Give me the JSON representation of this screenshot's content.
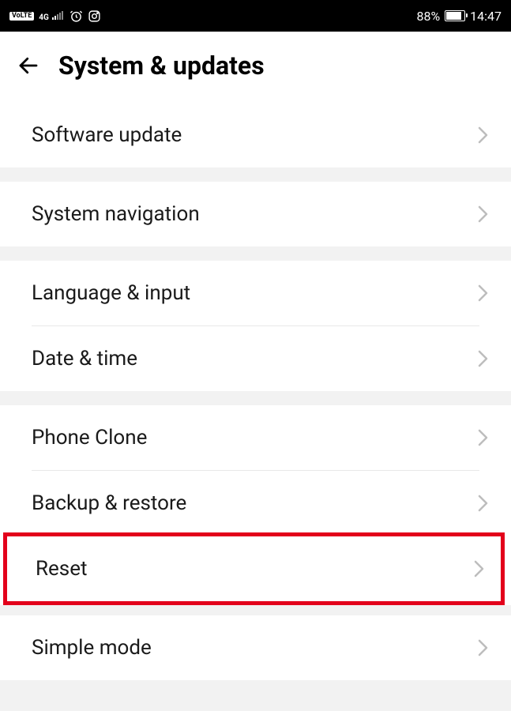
{
  "status_bar": {
    "volte": "VoLTE",
    "network": "4G",
    "battery_percent": "88%",
    "time": "14:47"
  },
  "header": {
    "title": "System & updates"
  },
  "groups": [
    {
      "items": [
        {
          "label": "Software update"
        }
      ]
    },
    {
      "items": [
        {
          "label": "System navigation"
        }
      ]
    },
    {
      "items": [
        {
          "label": "Language & input"
        },
        {
          "label": "Date & time"
        }
      ]
    },
    {
      "items": [
        {
          "label": "Phone Clone"
        },
        {
          "label": "Backup & restore"
        },
        {
          "label": "Reset"
        }
      ]
    },
    {
      "items": [
        {
          "label": "Simple mode"
        }
      ]
    }
  ]
}
